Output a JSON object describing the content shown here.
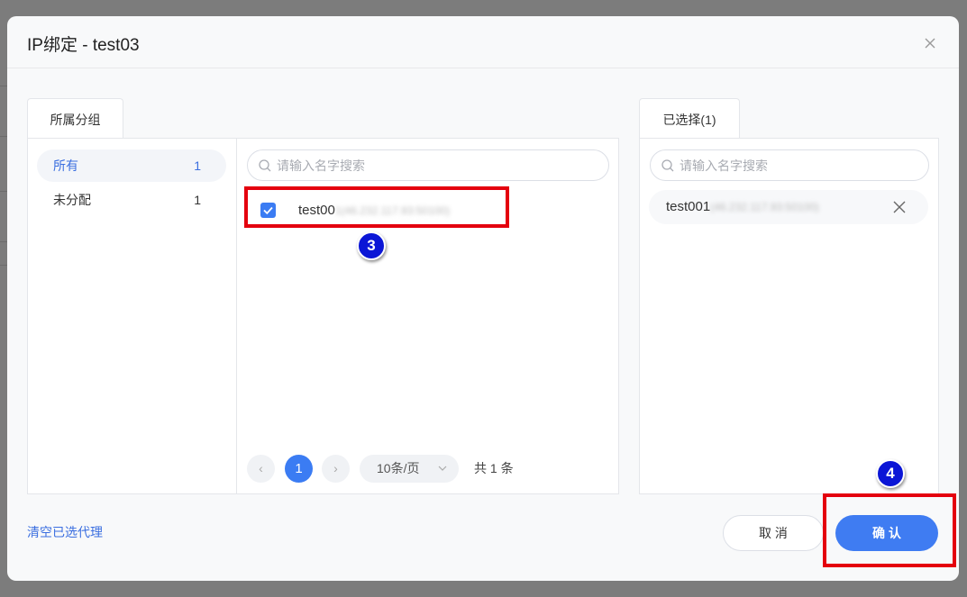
{
  "dialog": {
    "title": "IP绑定 - test03"
  },
  "tabs": {
    "groups": "所属分组",
    "selected": "已选择(1)"
  },
  "groups": [
    {
      "label": "所有",
      "count": "1"
    },
    {
      "label": "未分配",
      "count": "1"
    }
  ],
  "search": {
    "placeholder": "请输入名字搜索"
  },
  "list": {
    "item_prefix": "test00",
    "item_blurred": "1(46.232.117.93:50100)"
  },
  "selected": {
    "item_prefix": "test001",
    "item_blurred": "(46.232.117.93:50100)"
  },
  "pagination": {
    "prev": "‹",
    "current": "1",
    "next": "›",
    "page_size": "10条/页",
    "total": "共 1 条"
  },
  "footer": {
    "clear_label": "清空已选代理",
    "cancel_label": "取 消",
    "ok_label": "确 认"
  },
  "annotations": {
    "step3": "3",
    "step4": "4"
  },
  "colors": {
    "accent": "#3f7cf2",
    "highlight": "#e4000e",
    "marker": "#0b16d6"
  }
}
